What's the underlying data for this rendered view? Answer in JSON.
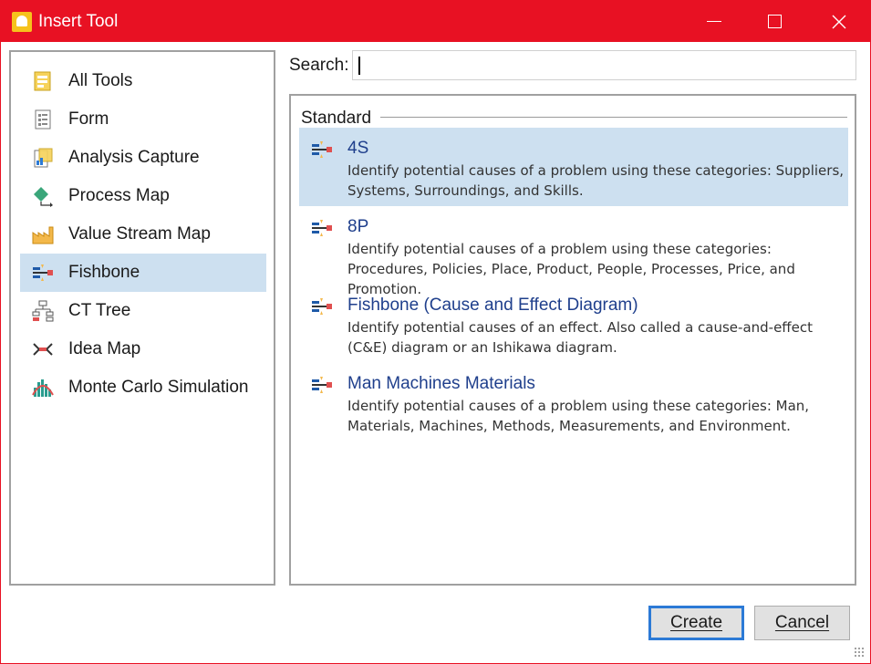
{
  "window": {
    "title": "Insert Tool",
    "accent": "#e81123",
    "controls": [
      "minimize-icon",
      "maximize-icon",
      "close-icon"
    ]
  },
  "sidebar": {
    "items": [
      {
        "label": "All Tools",
        "icon": "all-tools-icon"
      },
      {
        "label": "Form",
        "icon": "form-icon"
      },
      {
        "label": "Analysis Capture",
        "icon": "analysis-capture-icon"
      },
      {
        "label": "Process Map",
        "icon": "process-map-icon"
      },
      {
        "label": "Value Stream Map",
        "icon": "value-stream-map-icon"
      },
      {
        "label": "Fishbone",
        "icon": "fishbone-icon",
        "selected": true
      },
      {
        "label": "CT Tree",
        "icon": "ct-tree-icon"
      },
      {
        "label": "Idea Map",
        "icon": "idea-map-icon"
      },
      {
        "label": "Monte Carlo Simulation",
        "icon": "monte-carlo-icon"
      }
    ]
  },
  "search": {
    "label": "Search:",
    "value": ""
  },
  "main": {
    "group_label": "Standard",
    "tools": [
      {
        "name": "4S",
        "description": "Identify potential causes of a problem using these categories: Suppliers, Systems, Surroundings, and Skills.",
        "selected": true
      },
      {
        "name": "8P",
        "description": "Identify potential causes of a problem using these categories: Procedures, Policies, Place, Product, People, Processes, Price, and Promotion."
      },
      {
        "name": "Fishbone (Cause and Effect Diagram)",
        "description": "Identify potential causes of an effect. Also called a cause-and-effect (C&E) diagram or an Ishikawa diagram."
      },
      {
        "name": "Man Machines Materials",
        "description": "Identify potential causes of a problem using these categories: Man, Materials, Machines, Methods, Measurements, and Environment."
      }
    ]
  },
  "buttons": {
    "create": "Create",
    "cancel": "Cancel"
  },
  "colors": {
    "selection": "#cde0f0",
    "link_text": "#1f3f8c"
  }
}
